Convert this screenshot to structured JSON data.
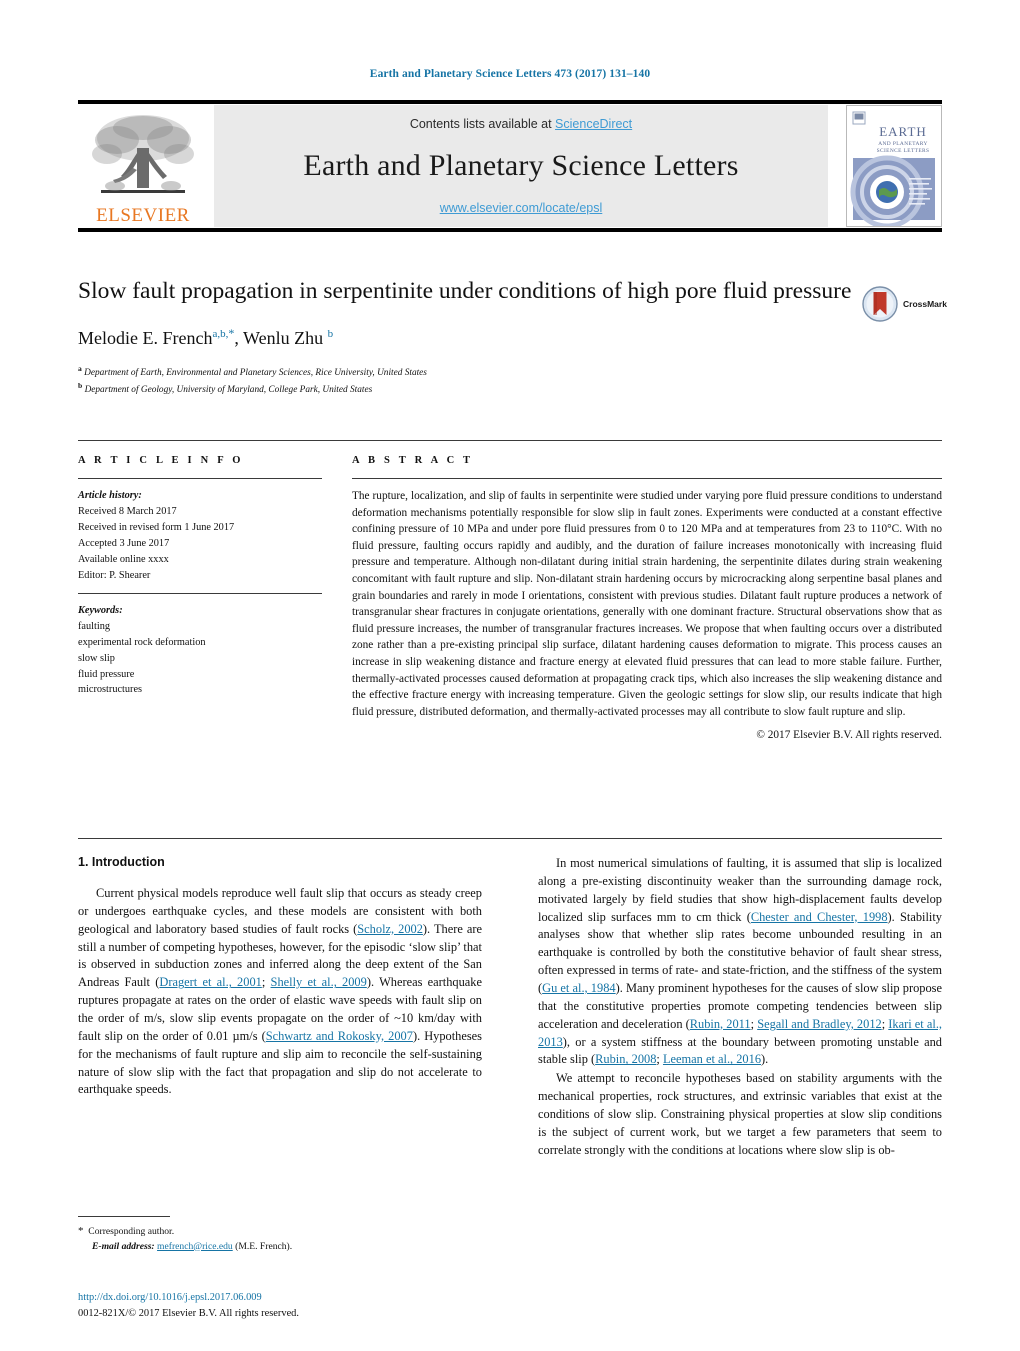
{
  "running_head": "Earth and Planetary Science Letters 473 (2017) 131–140",
  "masthead": {
    "contents_prefix": "Contents lists available at ",
    "sciencedirect": "ScienceDirect",
    "journal_title": "Earth and Planetary Science Letters",
    "journal_url": "www.elsevier.com/locate/epsl",
    "publisher_wordmark": "ELSEVIER",
    "cover_title_line1": "EARTH",
    "cover_title_line2": "AND PLANETARY",
    "cover_title_line3": "SCIENCE LETTERS"
  },
  "article": {
    "title": "Slow fault propagation in serpentinite under conditions of high pore fluid pressure",
    "authors_part1": "Melodie E. French",
    "author1_marks": "a,b,",
    "author1_star": "*",
    "authors_part2": ", Wenlu Zhu ",
    "author2_marks": "b",
    "affiliation_a": "Department of Earth, Environmental and Planetary Sciences, Rice University, United States",
    "affiliation_b": "Department of Geology, University of Maryland, College Park, United States",
    "crossmark_label": "CrossMark"
  },
  "article_info": {
    "heading": "A R T I C L E  I N F O",
    "history_label": "Article history:",
    "history": [
      "Received 8 March 2017",
      "Received in revised form 1 June 2017",
      "Accepted 3 June 2017",
      "Available online xxxx",
      "Editor: P. Shearer"
    ],
    "keywords_label": "Keywords:",
    "keywords": [
      "faulting",
      "experimental rock deformation",
      "slow slip",
      "fluid pressure",
      "microstructures"
    ]
  },
  "abstract": {
    "heading": "A B S T R A C T",
    "body": "The rupture, localization, and slip of faults in serpentinite were studied under varying pore fluid pressure conditions to understand deformation mechanisms potentially responsible for slow slip in fault zones. Experiments were conducted at a constant effective confining pressure of 10 MPa and under pore fluid pressures from 0 to 120 MPa and at temperatures from 23 to 110°C. With no fluid pressure, faulting occurs rapidly and audibly, and the duration of failure increases monotonically with increasing fluid pressure and temperature. Although non-dilatant during initial strain hardening, the serpentinite dilates during strain weakening concomitant with fault rupture and slip. Non-dilatant strain hardening occurs by microcracking along serpentine basal planes and grain boundaries and rarely in mode I orientations, consistent with previous studies. Dilatant fault rupture produces a network of transgranular shear fractures in conjugate orientations, generally with one dominant fracture. Structural observations show that as fluid pressure increases, the number of transgranular fractures increases. We propose that when faulting occurs over a distributed zone rather than a pre-existing principal slip surface, dilatant hardening causes deformation to migrate. This process causes an increase in slip weakening distance and fracture energy at elevated fluid pressures that can lead to more stable failure. Further, thermally-activated processes caused deformation at propagating crack tips, which also increases the slip weakening distance and the effective fracture energy with increasing temperature. Given the geologic settings for slow slip, our results indicate that high fluid pressure, distributed deformation, and thermally-activated processes may all contribute to slow fault rupture and slip.",
    "copyright": "© 2017 Elsevier B.V. All rights reserved."
  },
  "body": {
    "section_number_title": "1. Introduction",
    "left_paragraph_1": {
      "t1": "Current physical models reproduce well fault slip that occurs as steady creep or undergoes earthquake cycles, and these models are consistent with both geological and laboratory based studies of fault rocks (",
      "r1": "Scholz, 2002",
      "t2": "). There are still a number of competing hypotheses, however, for the episodic ‘slow slip’ that is observed in subduction zones and inferred along the deep extent of the San Andreas Fault (",
      "r2": "Dragert et al., 2001",
      "t3": "; ",
      "r3": "Shelly et al., 2009",
      "t4": "). Whereas earthquake ruptures propagate at rates on the order of elastic wave speeds with fault slip on the order of m/s, slow slip events propagate on the order of ~10 km/day with fault slip on the order of 0.01 µm/s (",
      "r4": "Schwartz and Rokosky, 2007",
      "t5": "). Hypotheses for the mechanisms of fault rupture and slip aim to reconcile the self-sustaining nature of slow slip with the fact that propagation and slip do not accelerate to earthquake speeds."
    },
    "right_paragraph_1": {
      "t1": "In most numerical simulations of faulting, it is assumed that slip is localized along a pre-existing discontinuity weaker than the surrounding damage rock, motivated largely by field studies that show high-displacement faults develop localized slip surfaces mm to cm thick (",
      "r1": "Chester and Chester, 1998",
      "t2": "). Stability analyses show that whether slip rates become unbounded resulting in an earthquake is controlled by both the constitutive behavior of fault shear stress, often expressed in terms of rate- and state-friction, and the stiffness of the system (",
      "r2": "Gu et al., 1984",
      "t3": "). Many prominent hypotheses for the causes of slow slip propose that the constitutive properties promote competing tendencies between slip acceleration and deceleration (",
      "r3": "Rubin, 2011",
      "t4": "; ",
      "r4": "Segall and Bradley, 2012",
      "t5": "; ",
      "r5": "Ikari et al., 2013",
      "t6": "), or a system stiffness at the boundary between promoting unstable and stable slip (",
      "r6": "Rubin, 2008",
      "t7": "; ",
      "r7": "Leeman et al., 2016",
      "t8": ")."
    },
    "right_paragraph_2": "We attempt to reconcile hypotheses based on stability arguments with the mechanical properties, rock structures, and extrinsic variables that exist at the conditions of slow slip. Constraining physical properties at slow slip conditions is the subject of current work, but we target a few parameters that seem to correlate strongly with the conditions at locations where slow slip is ob-"
  },
  "footnote": {
    "star": "*",
    "corresponding": "Corresponding author.",
    "email_label": "E-mail address:",
    "email": "mefrench@rice.edu",
    "email_suffix": "(M.E. French)."
  },
  "footer": {
    "doi": "http://dx.doi.org/10.1016/j.epsl.2017.06.009",
    "issn_line": "0012-821X/© 2017 Elsevier B.V. All rights reserved."
  },
  "colors": {
    "link": "#1674a5",
    "sciencedirect": "#3f9bd4",
    "elsevier_orange": "#E87722",
    "band_gray": "#eaeaea"
  }
}
